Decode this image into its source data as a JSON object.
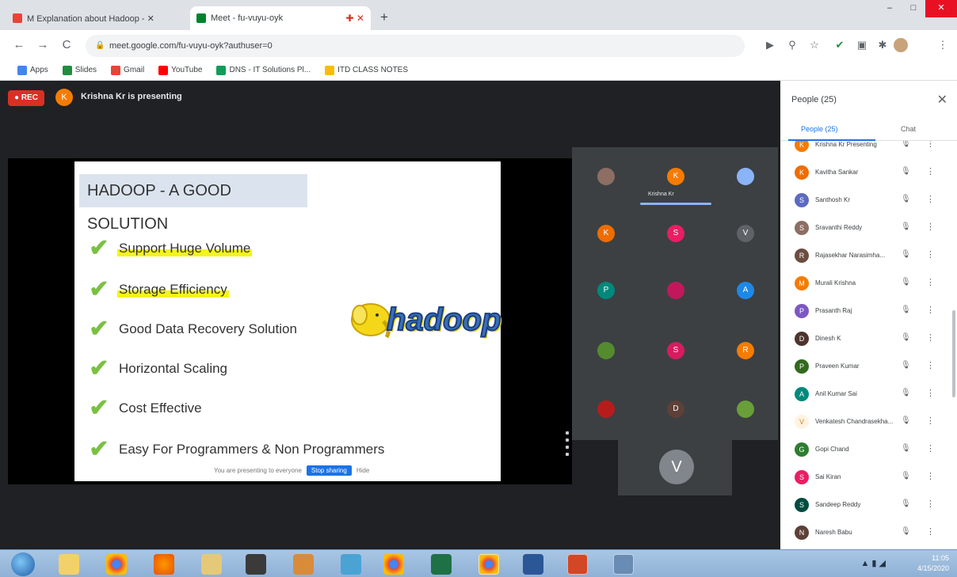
{
  "browser": {
    "tabs": [
      {
        "label": "M Explanation about Hadoop - ✕",
        "active": false,
        "favicon_color": "#ea4335"
      },
      {
        "label": "Meet - fu-vuyu-oyk",
        "active": true,
        "favicon_color": "#00832d"
      }
    ],
    "recording_dot": "✚ ✕",
    "new_tab": "+",
    "url": "meet.google.com/fu-vuyu-oyk?authuser=0",
    "nav": {
      "back": "←",
      "forward": "→",
      "reload": "C"
    },
    "extension_icons": [
      "cast-icon",
      "zoom-icon",
      "star-icon",
      "check-icon",
      "extension-icon",
      "puzzle-icon",
      "profile-icon",
      "menu-icon"
    ],
    "window_controls": {
      "minimize": "–",
      "maximize": "□",
      "close": "✕"
    }
  },
  "bookmarks": [
    {
      "label": "Apps",
      "color": "#4285f4"
    },
    {
      "label": "Slides",
      "color": "#1e8e3e"
    },
    {
      "label": "Gmail",
      "color": "#ea4335"
    },
    {
      "label": "YouTube",
      "color": "#ff0000"
    },
    {
      "label": "DNS - IT Solutions Pl...",
      "color": "#0f9d58"
    },
    {
      "label": "ITD CLASS NOTES",
      "color": "#fbbc04"
    }
  ],
  "meeting": {
    "rec_label": "● REC",
    "presenter_initial": "K",
    "presenting_label": "Krishna Kr is presenting"
  },
  "slide": {
    "title": "HADOOP - A GOOD SOLUTION",
    "bullets": [
      {
        "text": "Support Huge Volume",
        "highlight": true
      },
      {
        "text": "Storage Efficiency",
        "highlight": true
      },
      {
        "text": "Good Data Recovery Solution",
        "highlight": false
      },
      {
        "text": "Horizontal Scaling",
        "highlight": false
      },
      {
        "text": "Cost Effective",
        "highlight": false
      },
      {
        "text": "Easy For Programmers & Non Programmers",
        "highlight": false
      }
    ],
    "check_glyph": "✔",
    "logo_text": "hadoop",
    "present_bar_text": "You are presenting to everyone",
    "stop_label": "Stop sharing",
    "hide_label": "Hide"
  },
  "tiles": {
    "speaking_name": "Krishna Kr",
    "participants": [
      {
        "initial": "",
        "color": "#8d6e63"
      },
      {
        "initial": "K",
        "color": "#f57c00"
      },
      {
        "initial": "",
        "color": "#8ab4f8"
      },
      {
        "initial": "K",
        "color": "#ef6c00"
      },
      {
        "initial": "S",
        "color": "#e91e63"
      },
      {
        "initial": "V",
        "color": "#5f6368"
      },
      {
        "initial": "P",
        "color": "#00897b"
      },
      {
        "initial": "",
        "color": "#c2185b"
      },
      {
        "initial": "A",
        "color": "#1e88e5"
      },
      {
        "initial": "",
        "color": "#558b2f"
      },
      {
        "initial": "S",
        "color": "#d81b60"
      },
      {
        "initial": "R",
        "color": "#f57c00"
      },
      {
        "initial": "",
        "color": "#b71c1c"
      },
      {
        "initial": "D",
        "color": "#5d4037"
      },
      {
        "initial": "",
        "color": "#689f38"
      }
    ],
    "self_initial": "V"
  },
  "panel": {
    "title": "People (25)",
    "close": "✕",
    "tab_people": "People (25)",
    "tab_chat": "Chat",
    "people": [
      {
        "initial": "K",
        "name": "Krishna Kr Presenting",
        "color": "#f57c00"
      },
      {
        "initial": "K",
        "name": "Kavitha Sankar",
        "color": "#ef6c00"
      },
      {
        "initial": "S",
        "name": "Santhosh Kr",
        "color": "#5c6bc0"
      },
      {
        "initial": "S",
        "name": "Sravanthi Reddy",
        "color": "#8d6e63"
      },
      {
        "initial": "R",
        "name": "Rajasekhar Narasimha...",
        "color": "#6d4c41"
      },
      {
        "initial": "M",
        "name": "Murali Krishna",
        "color": "#f57c00"
      },
      {
        "initial": "P",
        "name": "Prasanth Raj",
        "color": "#7e57c2"
      },
      {
        "initial": "D",
        "name": "Dinesh K",
        "color": "#4e342e"
      },
      {
        "initial": "P",
        "name": "Praveen Kumar",
        "color": "#33691e"
      },
      {
        "initial": "A",
        "name": "Anil Kumar Sai",
        "color": "#00897b"
      },
      {
        "initial": "V",
        "name": "Venkatesh Chandrasekha...",
        "color": "#fff3e0"
      },
      {
        "initial": "G",
        "name": "Gopi Chand",
        "color": "#2e7d32"
      },
      {
        "initial": "S",
        "name": "Sai Kiran",
        "color": "#e91e63"
      },
      {
        "initial": "S",
        "name": "Sandeep Reddy",
        "color": "#004d40"
      },
      {
        "initial": "N",
        "name": "Naresh Babu",
        "color": "#5d4037"
      }
    ],
    "mic_glyph": "🎙",
    "more_glyph": "⋮"
  },
  "taskbar": {
    "apps": [
      "windows-explorer-icon",
      "chrome-icon",
      "firefox-icon",
      "folder-icon",
      "media-icon",
      "paint-icon",
      "network-icon",
      "chrome-icon",
      "excel-icon",
      "chrome-icon",
      "word-icon",
      "powerpoint-icon",
      "screen-icon"
    ],
    "time": "11:05",
    "date": "4/15/2020"
  }
}
